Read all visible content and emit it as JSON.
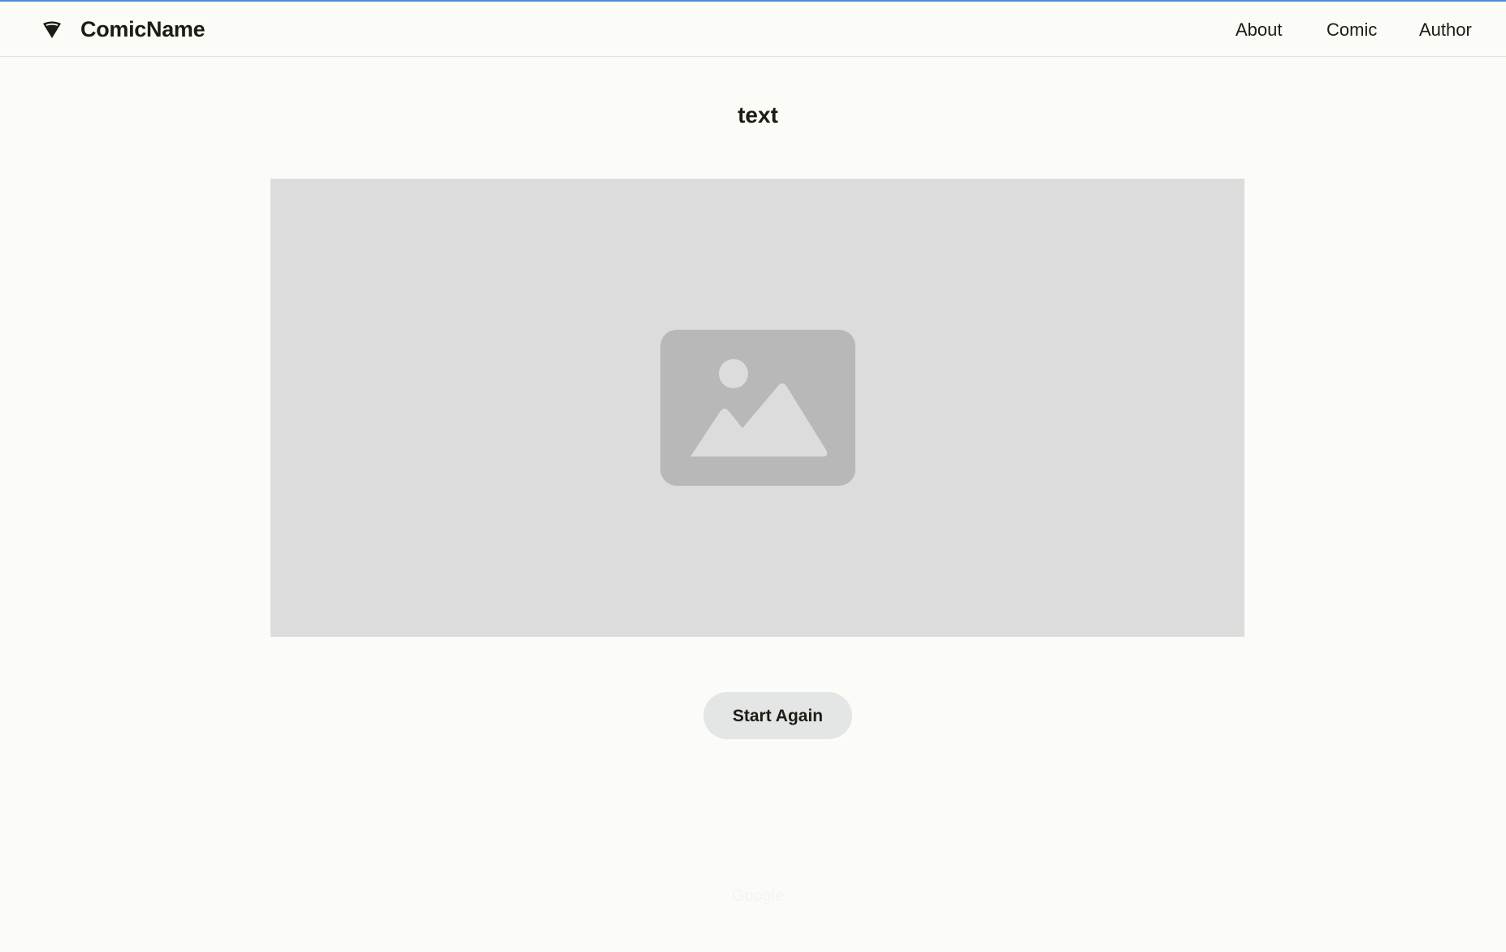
{
  "header": {
    "brand": "ComicName",
    "logo_icon": "cone-icon",
    "nav": {
      "about": "About",
      "comic": "Comic",
      "author": "Author"
    }
  },
  "main": {
    "title": "text",
    "image_icon": "image-placeholder-icon",
    "start_again_label": "Start Again"
  },
  "footer": {
    "text": "Google"
  },
  "colors": {
    "background": "#fbfcf8",
    "accent_line": "#4a90d9",
    "image_bg": "#dcdcdc",
    "image_icon": "#b8b8b8",
    "button_bg": "#e4e6e6"
  }
}
